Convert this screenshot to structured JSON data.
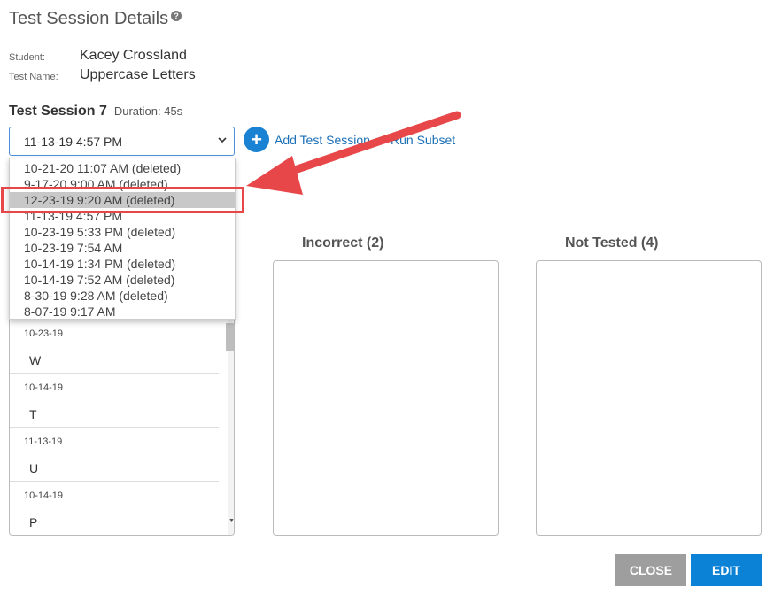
{
  "page": {
    "title": "Test Session Details",
    "help_icon": "?"
  },
  "student": {
    "label": "Student:",
    "value": "Kacey Crossland"
  },
  "test_name": {
    "label": "Test Name:",
    "value": "Uppercase Letters"
  },
  "session": {
    "title": "Test Session 7",
    "duration": "Duration: 45s",
    "selected": "11-13-19 4:57 PM"
  },
  "actions": {
    "add_icon": "+",
    "add_label": "Add Test Session",
    "run_subset": "Run Subset"
  },
  "dropdown": {
    "options": [
      "10-21-20 11:07 AM (deleted)",
      "9-17-20 9:00 AM (deleted)",
      "12-23-19 9:20 AM (deleted)",
      "11-13-19 4:57 PM",
      "10-23-19 5:33 PM (deleted)",
      "10-23-19 7:54 AM",
      "10-14-19 1:34 PM (deleted)",
      "10-14-19 7:52 AM (deleted)",
      "8-30-19 9:28 AM (deleted)",
      "8-07-19 9:17 AM"
    ],
    "highlighted_index": 2
  },
  "columns": {
    "incorrect": "Incorrect (2)",
    "not_tested": "Not Tested (4)"
  },
  "list": [
    {
      "date": "10-23-19",
      "letter": "W"
    },
    {
      "date": "10-14-19",
      "letter": "T"
    },
    {
      "date": "11-13-19",
      "letter": "U"
    },
    {
      "date": "10-14-19",
      "letter": "P"
    }
  ],
  "buttons": {
    "close": "CLOSE",
    "edit": "EDIT"
  },
  "colors": {
    "accent": "#1a82d3",
    "edit_button": "#0b82d6",
    "close_button": "#9e9e9e",
    "annotation_red": "#e8474a"
  }
}
